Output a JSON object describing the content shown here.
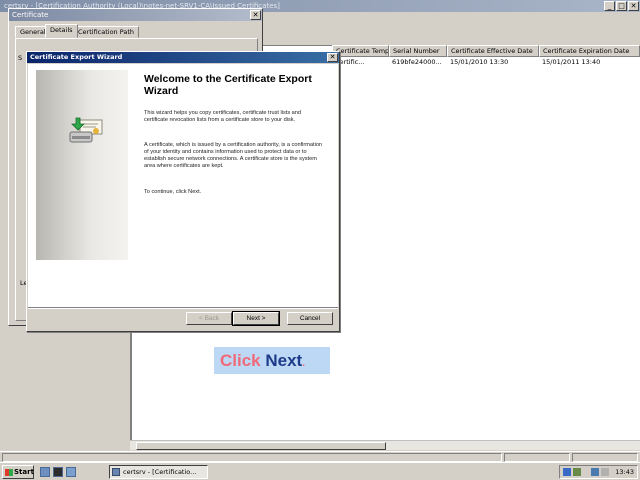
{
  "main_window": {
    "title": "certsrv - [Certification Authority (Local)\\notes-net-SRV1-CA\\Issued Certificates]",
    "columns": [
      "Certificate Template",
      "Serial Number",
      "Certificate Effective Date",
      "Certificate Expiration Date"
    ],
    "row": {
      "template": "Certific...",
      "serial": "619bfe24000...",
      "effective": "15/01/2010 13:30",
      "expiration": "15/01/2011 13:40"
    },
    "min_glyph": "_",
    "max_glyph": "□",
    "close_glyph": "✕"
  },
  "cert_dialog": {
    "title": "Certificate",
    "tabs": [
      "General",
      "Details",
      "Certification Path"
    ],
    "show_label": "S",
    "lower_label": "Le",
    "close_glyph": "✕"
  },
  "wizard": {
    "title": "Certificate Export Wizard",
    "close_glyph": "✕",
    "heading": "Welcome to the Certificate Export Wizard",
    "paragraph1": "This wizard helps you copy certificates, certificate trust lists and certificate revocation lists from a certificate store to your disk.",
    "paragraph2": "A certificate, which is issued by a certification authority, is a confirmation of your identity and contains information used to protect data or to establish secure network connections. A certificate store is the system area where certificates are kept.",
    "paragraph3": "To continue, click Next.",
    "back_label": "< Back",
    "next_label": "Next >",
    "cancel_label": "Cancel"
  },
  "callout": {
    "click": "Click",
    "next": "Next",
    "dot": "."
  },
  "taskbar": {
    "start_label": "Start",
    "task_label": "certsrv - [Certificatio...",
    "clock": "13:43"
  },
  "colors": {
    "title_active": "#0a246a",
    "callout_bg": "#bcd8f4",
    "callout_click": "#f06a7a",
    "callout_next": "#1e3a8a"
  }
}
